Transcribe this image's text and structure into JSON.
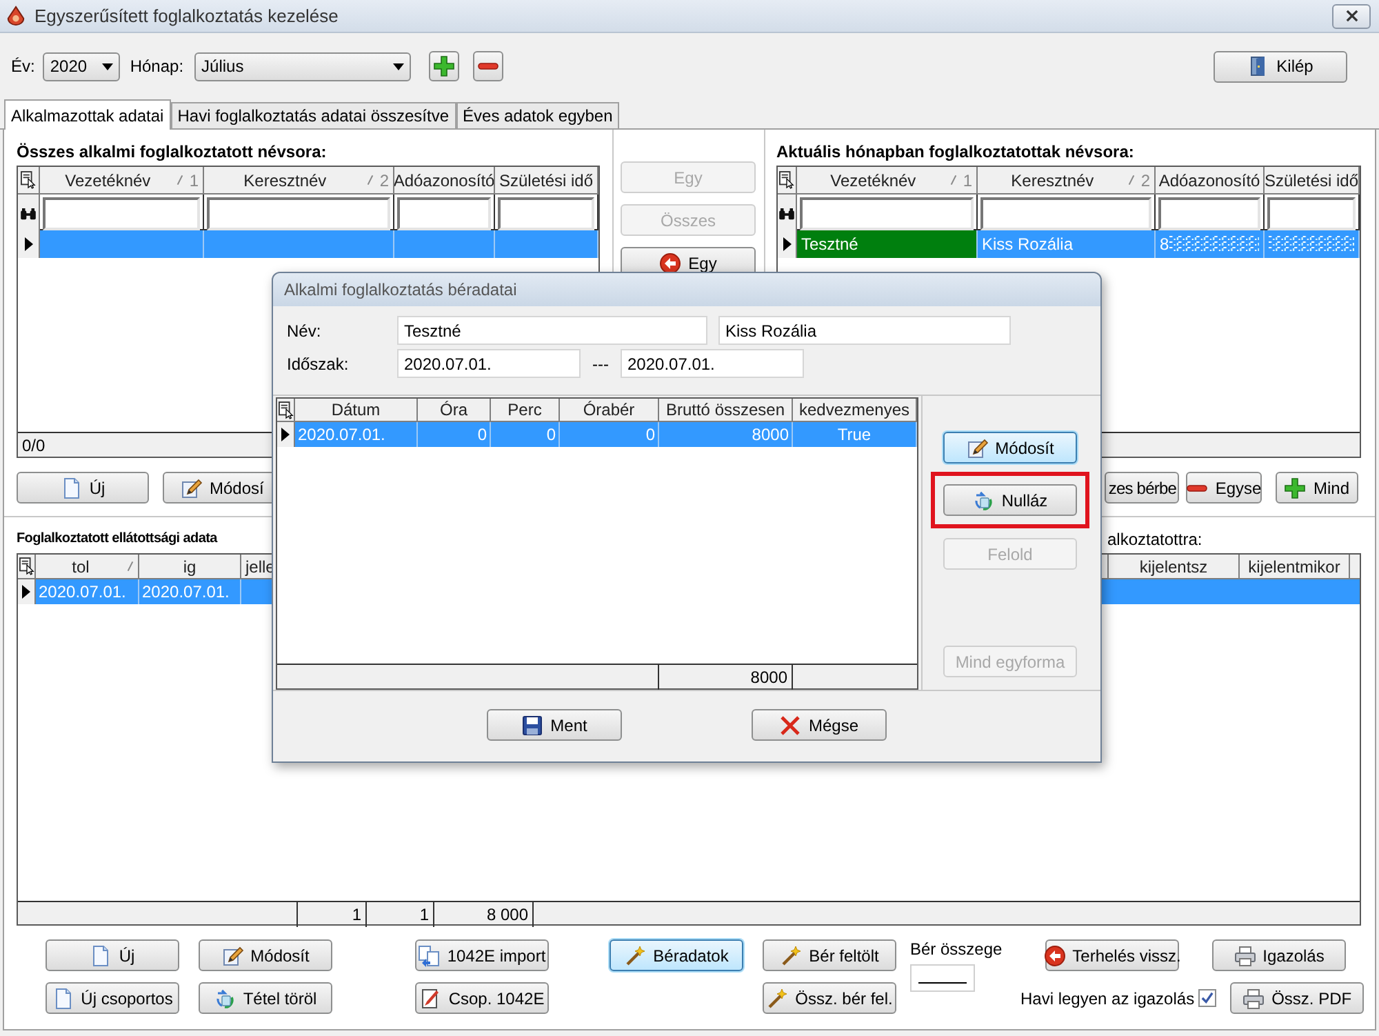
{
  "window": {
    "title": "Egyszerűsített foglalkoztatás kezelése"
  },
  "toolbar": {
    "year_label": "Év:",
    "year": "2020",
    "month_label": "Hónap:",
    "month": "Július",
    "exit_button": "Kilép"
  },
  "tabs": [
    {
      "label": "Alkalmazottak adatai",
      "selected": true
    },
    {
      "label": "Havi foglalkoztatás adatai összesítve",
      "selected": false
    },
    {
      "label": "Éves adatok egyben",
      "selected": false
    }
  ],
  "all_casual": {
    "heading": "Összes alkalmi foglalkoztatott névsora:",
    "columns": [
      {
        "label": "Vezetéknév",
        "sort": "1"
      },
      {
        "label": "Keresztnév",
        "sort": "2"
      },
      {
        "label": "Adóazonosító"
      },
      {
        "label": "Születési idő"
      }
    ],
    "rows": [
      {
        "selected": true
      }
    ],
    "footer": "0/0",
    "buttons": [
      {
        "label": "Új",
        "kind": "page"
      },
      {
        "label": "Módosí",
        "kind": "pencil"
      }
    ]
  },
  "transfer_buttons": [
    {
      "label": "Egy",
      "disabled": true,
      "kind": "plain"
    },
    {
      "label": "Összes",
      "disabled": true,
      "kind": "plain"
    },
    {
      "label": "Egy",
      "disabled": false,
      "kind": "back"
    }
  ],
  "current_month": {
    "heading": "Aktuális hónapban foglalkoztatottak névsora:",
    "columns": [
      {
        "label": "Vezetéknév",
        "sort": "1"
      },
      {
        "label": "Keresztnév",
        "sort": "2"
      },
      {
        "label": "Adóazonosító"
      },
      {
        "label": "Születési idő"
      }
    ],
    "rows": [
      {
        "selected": true,
        "cells": [
          {
            "text": "Tesztné",
            "marked": true
          },
          {
            "text": "Kiss Rozália",
            "marked": false
          },
          {
            "text": "8",
            "redacted": true
          },
          {
            "redacted": true
          }
        ]
      }
    ],
    "buttons": [
      {
        "label": "zes bérbe",
        "kind": "plain"
      },
      {
        "label": "Egyse",
        "kind": "minus"
      },
      {
        "label": "Mind",
        "kind": "plus"
      }
    ]
  },
  "supply_data": {
    "heading": "Foglalkoztatott ellátottsági adata",
    "right_heading": "alkoztatottra:",
    "columns": [
      {
        "label": "tol",
        "sorted": true
      },
      {
        "label": "ig",
        "sorted": false
      },
      {
        "label": "jelle",
        "sorted": false
      },
      {
        "label": "kijelentsz",
        "sorted": false
      },
      {
        "label": "kijelentmikor",
        "sorted": false
      }
    ],
    "rows": [
      {
        "selected": true,
        "cells": [
          "2020.07.01.",
          "2020.07.01."
        ]
      }
    ],
    "footer": [
      "1",
      "1",
      "8 000"
    ]
  },
  "bottom_actions": {
    "row_1": [
      {
        "label": "Új",
        "kind": "page"
      },
      {
        "label": "Módosít",
        "kind": "pencil"
      },
      {
        "label": "1042E import",
        "kind": "import"
      },
      {
        "label": "Béradatok",
        "kind": "wand",
        "focused": true
      },
      {
        "label": "Bér feltölt",
        "kind": "wand"
      },
      {
        "label": "Terhelés vissz.",
        "kind": "back"
      },
      {
        "label": "Igazolás",
        "kind": "printer"
      }
    ],
    "amount_label": "Bér összege",
    "row_2": [
      {
        "label": "Új csoportos",
        "kind": "page"
      },
      {
        "label": "Tétel töröl",
        "kind": "recycle"
      },
      {
        "label": "Csop. 1042E",
        "kind": "editdoc"
      },
      {
        "label": "Össz. bér fel.",
        "kind": "wand"
      },
      {
        "label": "Össz. PDF",
        "kind": "printer"
      }
    ],
    "monthly_certificate": {
      "label": "Havi legyen az igazolás",
      "checked": true
    }
  },
  "dialog": {
    "title": "Alkalmi foglalkoztatás béradatai",
    "name_label": "Név:",
    "last_name": "Tesztné",
    "first_name": "Kiss Rozália",
    "period_label": "Időszak:",
    "period_from": "2020.07.01.",
    "period_separator": "---",
    "period_to": "2020.07.01.",
    "columns": [
      "Dátum",
      "Óra",
      "Perc",
      "Órabér",
      "Bruttó összesen",
      "kedvezmenyes"
    ],
    "rows": [
      {
        "selected": true,
        "cells": [
          "2020.07.01.",
          "0",
          "0",
          "0",
          "8000",
          "True"
        ]
      }
    ],
    "total": "8000",
    "side_buttons": [
      {
        "label": "Módosít",
        "kind": "pencil",
        "disabled": false,
        "focused": true,
        "highlighted": false
      },
      {
        "label": "Nulláz",
        "kind": "recycle",
        "disabled": false,
        "focused": false,
        "highlighted": true
      },
      {
        "label": "Felold",
        "kind": "plain",
        "disabled": true,
        "focused": false,
        "highlighted": false
      },
      {
        "label": "Mind egyforma",
        "kind": "plain",
        "disabled": true,
        "focused": false,
        "highlighted": false
      }
    ],
    "buttons": [
      {
        "label": "Ment",
        "kind": "save"
      },
      {
        "label": "Mégse",
        "kind": "cancel"
      }
    ]
  }
}
